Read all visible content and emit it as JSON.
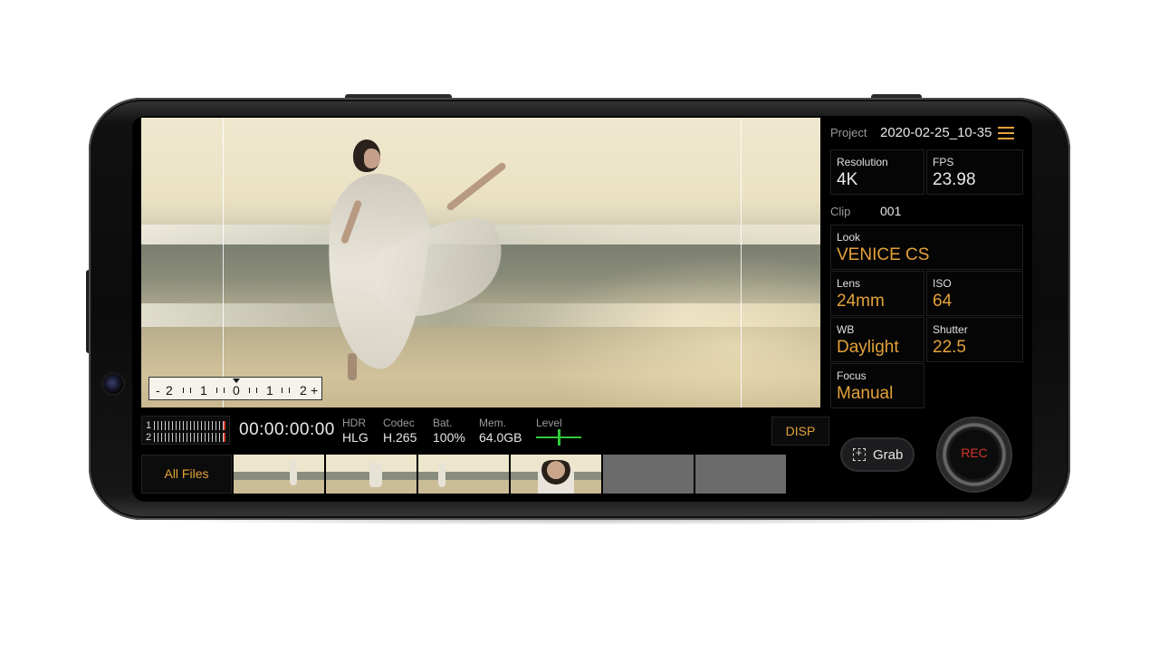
{
  "viewfinder": {
    "level_scale": [
      "-",
      "2",
      "1",
      "0",
      "1",
      "2",
      "+"
    ]
  },
  "status": {
    "audio_ch1": "1",
    "audio_ch2": "2",
    "timecode": "00:00:00:00",
    "hdr_label": "HDR",
    "hdr_value": "HLG",
    "codec_label": "Codec",
    "codec_value": "H.265",
    "battery_label": "Bat.",
    "battery_value": "100%",
    "memory_label": "Mem.",
    "memory_value": "64.0GB",
    "level_label": "Level",
    "disp_label": "DISP"
  },
  "thumbnails": {
    "all_files_label": "All Files"
  },
  "panel": {
    "project_label": "Project",
    "project_value": "2020-02-25_10-35",
    "resolution_label": "Resolution",
    "resolution_value": "4K",
    "fps_label": "FPS",
    "fps_value": "23.98",
    "clip_label": "Clip",
    "clip_value": "001",
    "look_label": "Look",
    "look_value": "VENICE CS",
    "lens_label": "Lens",
    "lens_value": "24mm",
    "iso_label": "ISO",
    "iso_value": "64",
    "wb_label": "WB",
    "wb_value": "Daylight",
    "shutter_label": "Shutter",
    "shutter_value": "22.5",
    "focus_label": "Focus",
    "focus_value": "Manual",
    "grab_label": "Grab",
    "rec_label": "REC"
  },
  "colors": {
    "accent": "#e3a23a",
    "rec_red": "#d2362a",
    "level_green": "#2fc93b"
  }
}
